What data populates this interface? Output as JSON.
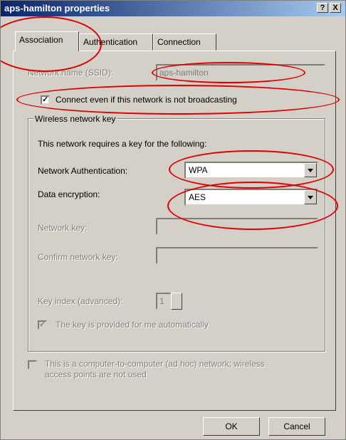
{
  "window": {
    "title": "aps-hamilton properties",
    "help_btn": "?",
    "close_btn": "X"
  },
  "tabs": [
    {
      "label": "Association"
    },
    {
      "label": "Authentication"
    },
    {
      "label": "Connection"
    }
  ],
  "association": {
    "ssid_label": "Network name (SSID):",
    "ssid_value": "aps-hamilton",
    "broadcast_check_label": "Connect even if this network is not broadcasting",
    "broadcast_checked": "✓",
    "group_title": "Wireless network key",
    "key_intro": "This network requires a key for the following:",
    "auth_label": "Network Authentication:",
    "auth_value": "WPA",
    "enc_label": "Data encryption:",
    "enc_value": "AES",
    "netkey_label": "Network key:",
    "confirm_label": "Confirm network key:",
    "keyindex_label": "Key index (advanced):",
    "keyindex_value": "1",
    "auto_key_label": "The key is provided for me automatically",
    "auto_key_checked": "✓",
    "adhoc_line1": "This is a computer-to-computer (ad hoc) network; wireless",
    "adhoc_line2": "access points are not used"
  },
  "buttons": {
    "ok": "OK",
    "cancel": "Cancel"
  },
  "colors": {
    "annotation": "#e00000",
    "titlebar": "#0a246a"
  }
}
